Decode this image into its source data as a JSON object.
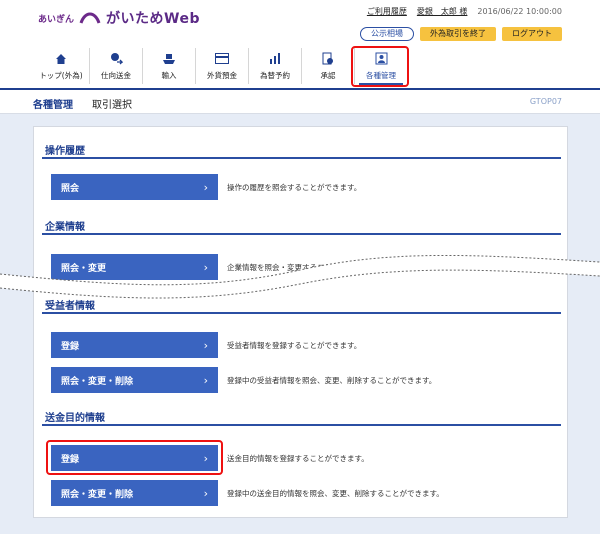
{
  "header": {
    "logo_small": "あいぎん",
    "logo_main": "がいためWeb",
    "user_link": "ご利用履歴",
    "user_name": "愛銀　太郎 様",
    "datetime": "2016/06/22 10:00:00",
    "rate_button": "公示相場",
    "end_button": "外為取引を終了",
    "logout_button": "ログアウト"
  },
  "nav": [
    {
      "label": "トップ(外為)",
      "icon": "home-icon"
    },
    {
      "label": "仕向送金",
      "icon": "remittance-icon"
    },
    {
      "label": "輸入",
      "icon": "ship-icon"
    },
    {
      "label": "外貨預金",
      "icon": "deposit-icon"
    },
    {
      "label": "為替予約",
      "icon": "chart-icon"
    },
    {
      "label": "承認",
      "icon": "approval-icon"
    },
    {
      "label": "各種管理",
      "icon": "user-admin-icon"
    }
  ],
  "subbar": {
    "title": "各種管理",
    "subtitle": "取引選択",
    "code": "GTOP07"
  },
  "sections": {
    "history": {
      "title": "操作履歴",
      "rows": [
        {
          "button": "照会",
          "desc": "操作の履歴を照会することができます。"
        }
      ]
    },
    "company": {
      "title": "企業情報",
      "rows": [
        {
          "button": "照会・変更",
          "desc": "企業情報を照会・変更することができます。"
        }
      ]
    },
    "beneficiary": {
      "title": "受益者情報",
      "rows": [
        {
          "button": "登録",
          "desc": "受益者情報を登録することができます。"
        },
        {
          "button": "照会・変更・削除",
          "desc": "登録中の受益者情報を照会、変更、削除することができます。"
        }
      ]
    },
    "purpose": {
      "title": "送金目的情報",
      "rows": [
        {
          "button": "登録",
          "desc": "送金目的情報を登録することができます。"
        },
        {
          "button": "照会・変更・削除",
          "desc": "登録中の送金目的情報を照会、変更、削除することができます。"
        }
      ]
    }
  },
  "colors": {
    "primary": "#2b4fa3",
    "button": "#3a64c0",
    "accent": "#f6c23f",
    "highlight": "#ee1111"
  }
}
